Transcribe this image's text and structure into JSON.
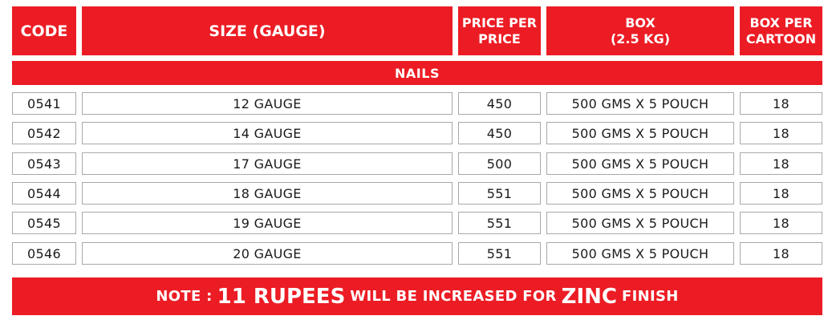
{
  "headers": {
    "code": "CODE",
    "size": "SIZE (GAUGE)",
    "price_line1": "PRICE PER",
    "price_line2": "PRICE",
    "box_line1": "BOX",
    "box_line2": "(2.5 KG)",
    "cartoon_line1": "BOX PER",
    "cartoon_line2": "CARTOON"
  },
  "section_title": "NAILS",
  "rows": [
    {
      "code": "0541",
      "size": "12 GAUGE",
      "price": "450",
      "box": "500 GMS X 5 POUCH",
      "per_cartoon": "18"
    },
    {
      "code": "0542",
      "size": "14 GAUGE",
      "price": "450",
      "box": "500 GMS X 5 POUCH",
      "per_cartoon": "18"
    },
    {
      "code": "0543",
      "size": "17 GAUGE",
      "price": "500",
      "box": "500 GMS X 5 POUCH",
      "per_cartoon": "18"
    },
    {
      "code": "0544",
      "size": "18 GAUGE",
      "price": "551",
      "box": "500 GMS X 5 POUCH",
      "per_cartoon": "18"
    },
    {
      "code": "0545",
      "size": "19 GAUGE",
      "price": "551",
      "box": "500 GMS X 5 POUCH",
      "per_cartoon": "18"
    },
    {
      "code": "0546",
      "size": "20 GAUGE",
      "price": "551",
      "box": "500 GMS X 5 POUCH",
      "per_cartoon": "18"
    }
  ],
  "note": {
    "prefix": "NOTE :",
    "amount": "11 RUPEES",
    "middle": "WILL BE INCREASED FOR",
    "metal": "ZINC",
    "suffix": "FINISH"
  },
  "colors": {
    "accent": "#ec1c24",
    "cell_border": "#a8a8a8",
    "text": "#1a1a1a"
  }
}
